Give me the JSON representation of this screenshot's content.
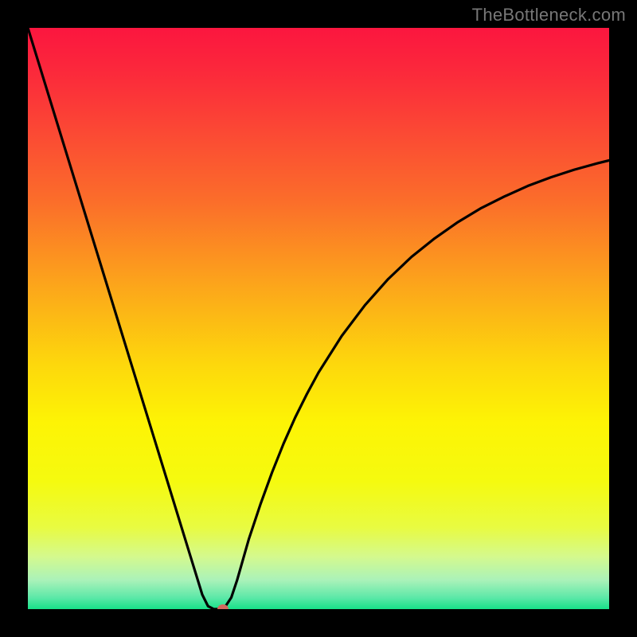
{
  "watermark": {
    "text": "TheBottleneck.com"
  },
  "chart_data": {
    "type": "line",
    "title": "",
    "xlabel": "",
    "ylabel": "",
    "xlim": [
      0,
      100
    ],
    "ylim": [
      0,
      100
    ],
    "x": [
      0,
      2,
      4,
      6,
      8,
      10,
      12,
      14,
      16,
      18,
      20,
      22,
      24,
      26,
      28,
      30,
      31,
      32,
      33,
      34,
      35,
      36,
      37,
      38,
      40,
      42,
      44,
      46,
      48,
      50,
      54,
      58,
      62,
      66,
      70,
      74,
      78,
      82,
      86,
      90,
      94,
      98,
      100
    ],
    "values": [
      100,
      93.5,
      87,
      80.5,
      74,
      67.5,
      61,
      54.5,
      48,
      41.5,
      35,
      28.5,
      22,
      15.5,
      9,
      2.5,
      0.5,
      0,
      0,
      0.5,
      2,
      5,
      8.5,
      12,
      18,
      23.5,
      28.5,
      33,
      37,
      40.7,
      47,
      52.3,
      56.8,
      60.6,
      63.8,
      66.6,
      69,
      71,
      72.8,
      74.3,
      75.6,
      76.7,
      77.2
    ],
    "marker": {
      "x": 33.5,
      "y": 0
    },
    "gradient_stops": [
      {
        "offset": 0.0,
        "color": "#fb163f"
      },
      {
        "offset": 0.08,
        "color": "#fb2a3b"
      },
      {
        "offset": 0.18,
        "color": "#fb4934"
      },
      {
        "offset": 0.3,
        "color": "#fb6e2a"
      },
      {
        "offset": 0.45,
        "color": "#fca81a"
      },
      {
        "offset": 0.58,
        "color": "#fdd80c"
      },
      {
        "offset": 0.68,
        "color": "#fdf405"
      },
      {
        "offset": 0.78,
        "color": "#f5fa0f"
      },
      {
        "offset": 0.86,
        "color": "#e8fb42"
      },
      {
        "offset": 0.91,
        "color": "#d4f98e"
      },
      {
        "offset": 0.95,
        "color": "#aaf2b9"
      },
      {
        "offset": 0.98,
        "color": "#5de8a8"
      },
      {
        "offset": 1.0,
        "color": "#17e188"
      }
    ],
    "legend": [],
    "grid": false
  }
}
